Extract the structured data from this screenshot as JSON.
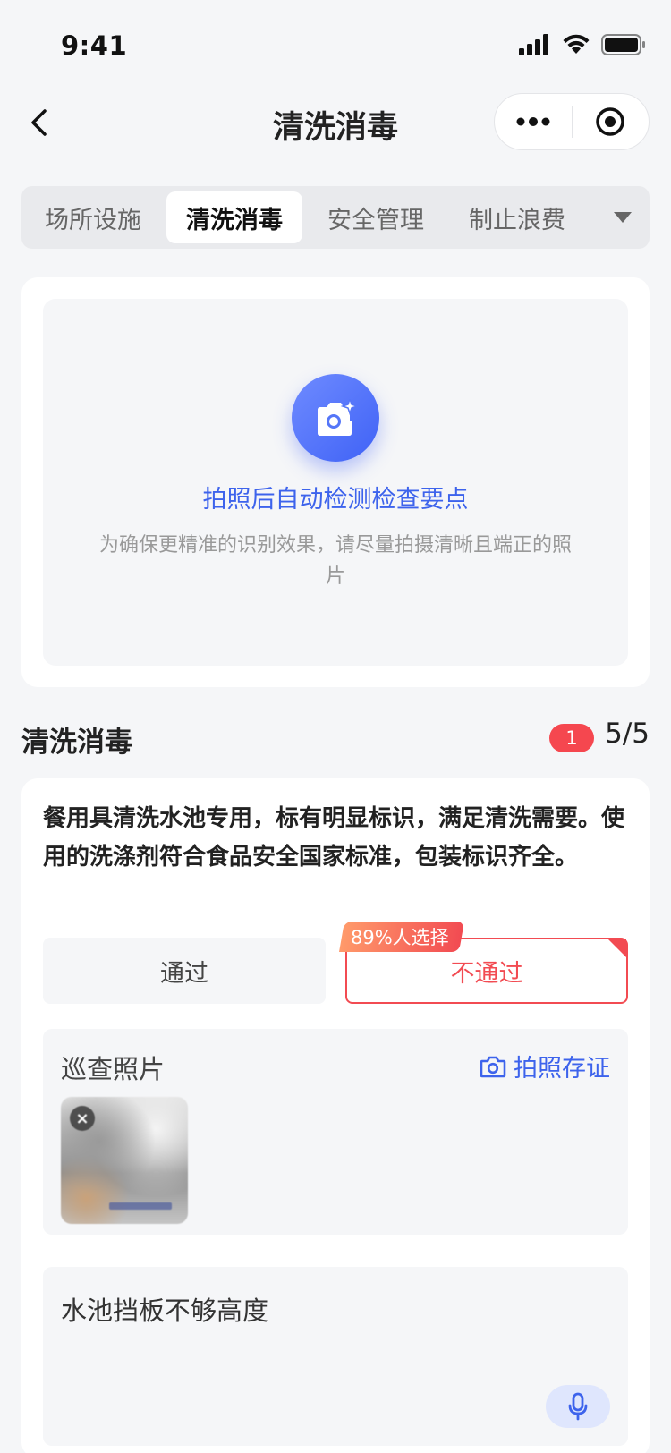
{
  "status_bar": {
    "time": "9:41"
  },
  "nav": {
    "title": "清洗消毒"
  },
  "tabs": [
    {
      "label": "场所设施",
      "active": false
    },
    {
      "label": "清洗消毒",
      "active": true
    },
    {
      "label": "安全管理",
      "active": false
    },
    {
      "label": "制止浪费",
      "active": false
    }
  ],
  "photo_card": {
    "title": "拍照后自动检测检查要点",
    "subtitle": "为确保更精准的识别效果，请尽量拍摄清晰且端正的照片"
  },
  "section": {
    "title": "清洗消毒",
    "badge": "1",
    "count": "5/5"
  },
  "item": {
    "description": "餐用具清洗水池专用，标有明显标识，满足清洗需要。使用的洗涤剂符合食品安全国家标准，包装标识齐全。",
    "pass_label": "通过",
    "fail_label": "不通过",
    "selected": "不通过",
    "popularity_tag": "89%人选择",
    "evidence_label": "巡查照片",
    "evidence_action": "拍照存证",
    "note": "水池挡板不够高度"
  },
  "colors": {
    "accent_blue": "#3d63ec",
    "fail_red": "#f24b52",
    "background": "#f5f6f8"
  }
}
